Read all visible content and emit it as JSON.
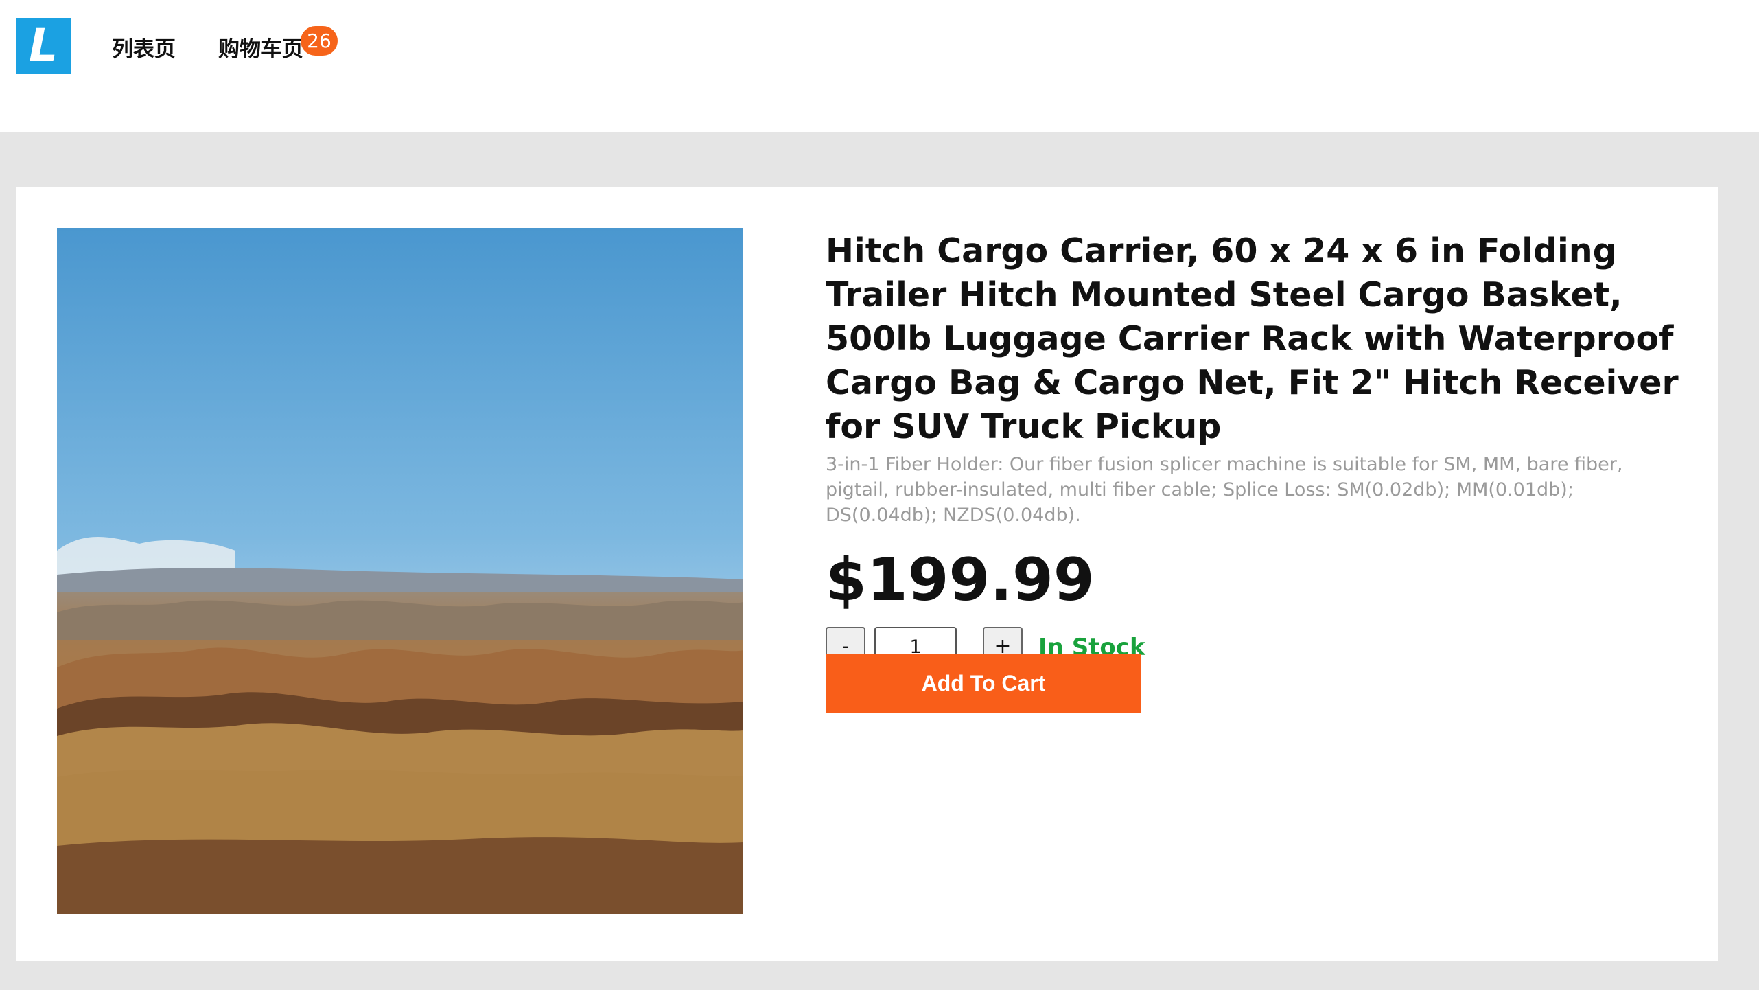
{
  "header": {
    "logo_text": "L",
    "nav": {
      "list_label": "列表页",
      "cart_label": "购物车页",
      "cart_count": "26"
    }
  },
  "product": {
    "title": "Hitch Cargo Carrier, 60 x 24 x 6 in Folding Trailer Hitch Mounted Steel Cargo Basket, 500lb Luggage Carrier Rack with Waterproof Cargo Bag & Cargo Net, Fit 2\" Hitch Receiver for SUV Truck Pickup",
    "description": "3-in-1 Fiber Holder: Our fiber fusion splicer machine is suitable for SM, MM, bare fiber, pigtail, rubber-insulated, multi fiber cable; Splice Loss: SM(0.02db); MM(0.01db); DS(0.04db); NZDS(0.04db).",
    "price": "$199.99",
    "quantity": {
      "minus_label": "-",
      "plus_label": "+",
      "value": "1"
    },
    "stock_status": "In Stock",
    "add_to_cart_label": "Add To Cart"
  },
  "colors": {
    "logo": "#1ba1e2",
    "badge": "#f6641a",
    "in_stock": "#19a23c",
    "add_to_cart": "#f95e19",
    "page_background": "#e5e5e5"
  }
}
